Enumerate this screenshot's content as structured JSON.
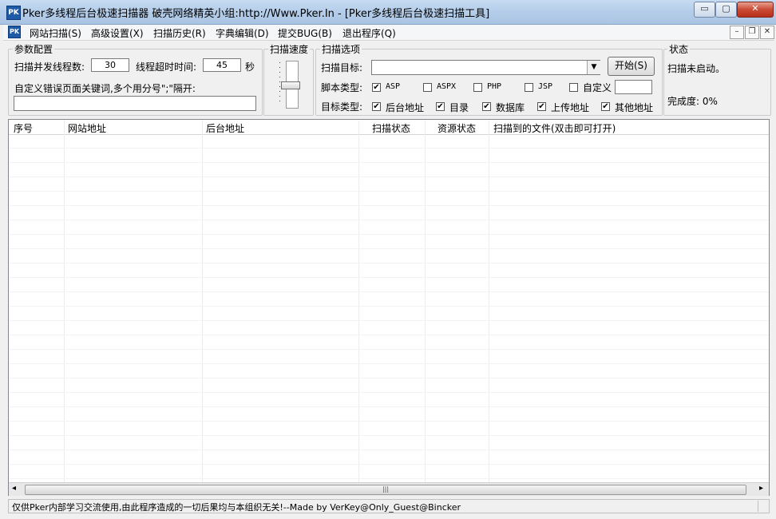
{
  "window": {
    "title": "Pker多线程后台极速扫描器  破壳网络精英小组:http://Www.Pker.In  - [Pker多线程后台极速扫描工具]",
    "icon_text": "PK",
    "minimize": "▭",
    "maximize": "▢",
    "close": "✕"
  },
  "menu": {
    "items": [
      "网站扫描(S)",
      "高级设置(X)",
      "扫描历史(R)",
      "字典编辑(D)",
      "提交BUG(B)",
      "退出程序(Q)"
    ],
    "mdi_minimize": "–",
    "mdi_restore": "❐",
    "mdi_close": "✕"
  },
  "params": {
    "group_title": "参数配置",
    "threads_label": "扫描并发线程数:",
    "threads_value": "30",
    "timeout_label": "线程超时时间:",
    "timeout_value": "45",
    "timeout_unit": "秒",
    "keywords_label": "自定义错误页面关键词,多个用分号\";\"隔开:",
    "keywords_value": ""
  },
  "speed": {
    "group_title": "扫描速度",
    "level": 0.5
  },
  "options": {
    "group_title": "扫描选项",
    "target_label": "扫描目标:",
    "target_value": "",
    "start_button": "开始(S)",
    "script_label": "脚本类型:",
    "scripts": [
      {
        "label": "ASP",
        "checked": true
      },
      {
        "label": "ASPX",
        "checked": false
      },
      {
        "label": "PHP",
        "checked": false
      },
      {
        "label": "JSP",
        "checked": false
      },
      {
        "label": "自定义",
        "checked": false
      }
    ],
    "target_type_label": "目标类型:",
    "target_types": [
      {
        "label": "后台地址",
        "checked": true
      },
      {
        "label": "目录",
        "checked": true
      },
      {
        "label": "数据库",
        "checked": true
      },
      {
        "label": "上传地址",
        "checked": true
      },
      {
        "label": "其他地址",
        "checked": true
      }
    ],
    "check_mark": "✔"
  },
  "status": {
    "group_title": "状态",
    "state_text": "扫描未启动。",
    "progress_text": "完成度: 0%"
  },
  "table": {
    "columns": [
      "序号",
      "网站地址",
      "后台地址",
      "扫描状态",
      "资源状态",
      "扫描到的文件(双击即可打开)"
    ],
    "rows": [],
    "scroll_left": "◂",
    "scroll_right": "▸",
    "scroll_grip": "|||"
  },
  "footer": {
    "text": "仅供Pker内部学习交流使用,由此程序造成的一切后果均与本组织无关!--Made by VerKey@Only_Guest@Bincker"
  }
}
